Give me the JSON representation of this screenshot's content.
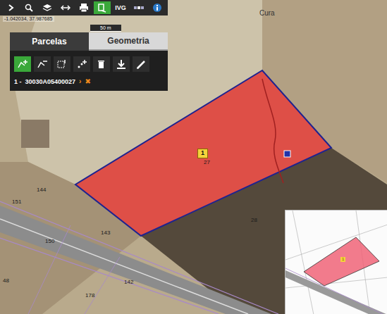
{
  "toolbar": {
    "buttons": [
      {
        "kind": "arrow",
        "selected": false
      },
      {
        "kind": "search",
        "selected": false
      },
      {
        "kind": "layers",
        "selected": false
      },
      {
        "kind": "measure",
        "selected": false
      },
      {
        "kind": "print",
        "selected": false
      },
      {
        "kind": "parcel",
        "selected": true
      },
      {
        "kind": "text",
        "label": "IVG",
        "selected": false
      },
      {
        "kind": "satellite",
        "selected": false
      },
      {
        "kind": "info",
        "selected": false
      }
    ]
  },
  "coordinates": "-1.042034, 37.987685",
  "scale": "50 m",
  "panel": {
    "tabs": [
      {
        "label": "Parcelas",
        "selected": true
      },
      {
        "label": "Geometria",
        "selected": false
      }
    ],
    "tools": [
      {
        "kind": "add",
        "selected": true
      },
      {
        "kind": "remove",
        "selected": false
      },
      {
        "kind": "select",
        "selected": false
      },
      {
        "kind": "addmulti",
        "selected": false
      },
      {
        "kind": "delete",
        "selected": false
      },
      {
        "kind": "download",
        "selected": false
      },
      {
        "kind": "edit",
        "selected": false
      }
    ],
    "parcels": [
      {
        "index": "1 -",
        "ref": "30030A05400027",
        "go": "›",
        "remove": "✖"
      }
    ]
  },
  "map": {
    "place": "Cura",
    "parcel_badge": "1",
    "labels": [
      "27",
      "144",
      "151",
      "143",
      "150",
      "142",
      "178",
      "48",
      "28"
    ]
  },
  "inset": {
    "badge": "1"
  }
}
